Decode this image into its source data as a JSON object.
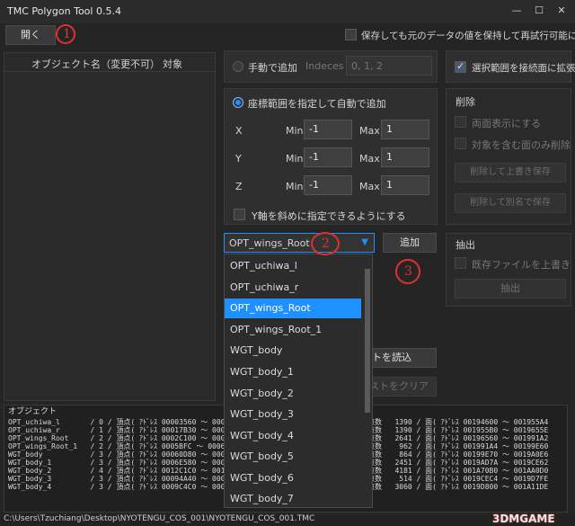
{
  "window": {
    "title": "TMC Polygon Tool 0.5.4",
    "minimize": "—",
    "maximize": "☐",
    "close": "✕"
  },
  "toolbar": {
    "open_label": "開く",
    "keep_values_label": "保存しても元のデータの値を保持して再試行可能にする"
  },
  "object_list": {
    "col_name": "オブジェクト名（変更不可）",
    "col_object": "対象"
  },
  "manual_add": {
    "label": "手動で追加",
    "indices_label": "Indeces",
    "indices_placeholder": "0, 1, 2"
  },
  "auto_add": {
    "label": "座標範囲を指定して自動で追加",
    "x_label": "X",
    "y_label": "Y",
    "z_label": "Z",
    "min_label": "Min",
    "max_label": "Max",
    "x_min": "-1",
    "x_max": "1",
    "y_min": "-1",
    "y_max": "1",
    "z_min": "-1",
    "z_max": "1",
    "y_oblique_label": "Y軸を斜めに指定できるようにする"
  },
  "object_select": {
    "value": "OPT_wings_Root",
    "add_label": "追加",
    "options": [
      "OPT_uchiwa_l",
      "OPT_uchiwa_r",
      "OPT_wings_Root",
      "OPT_wings_Root_1",
      "WGT_body",
      "WGT_body_1",
      "WGT_body_2",
      "WGT_body_3",
      "WGT_body_4",
      "WGT_body_5",
      "WGT_body_6",
      "WGT_body_7"
    ],
    "selected_index": 2
  },
  "hidden_buttons": {
    "load_list": "トを読込",
    "clear_list": "ストをクリア"
  },
  "right_panel": {
    "expand_selection_label": "選択範囲を接続面に拡張",
    "delete_title": "削除",
    "double_sided_label": "両面表示にする",
    "only_contained_label": "対象を含む面のみ削除",
    "delete_overwrite_label": "削除して上書き保存",
    "delete_save_as_label": "削除して別名で保存",
    "extract_title": "抽出",
    "overwrite_existing_label": "既存ファイルを上書き",
    "extract_label": "抽出"
  },
  "log": {
    "header": "オブジェクト",
    "lines": [
      "OPT_uchiwa_l       / 0 / 頂点( ｱﾄﾞﾚｽ 00003560 ～ 0001",
      "OPT_uchiwa_r       / 1 / 頂点( ｱﾄﾞﾚｽ 00017B30 ～ 0002",
      "OPT_wings_Root     / 2 / 頂点( ｱﾄﾞﾚｽ 0002C100 ～ 0005",
      "OPT_wings_Root_1   / 2 / 頂点( ｱﾄﾞﾚｽ 0005BFC ～ 0006",
      "WGT_body           / 3 / 頂点( ｱﾄﾞﾚｽ 00060D80 ～ 0006",
      "WGT_body_1         / 3 / 頂点( ｱﾄﾞﾚｽ 0006E580 ～ 0001",
      "WGT_body_2         / 4 / 頂点( ｱﾄﾞﾚｽ 0012C1C0 ～ 0016",
      "WGT_body_3         / 3 / 頂点( ｱﾄﾞﾚｽ 00094A40 ～ 0009",
      "WGT_body_4         / 3 / 頂点( ｱﾄﾞﾚｽ 0009C4C0 ～ 0000"
    ],
    "right_lines": [
      "点数   1390 / 面( ｱﾄﾞﾚｽ 00194600 ～ 001955A4",
      "点数   1390 / 面( ｱﾄﾞﾚｽ 001955B0 ～ 0019655E",
      "点数   2641 / 面( ｱﾄﾞﾚｽ 00196560 ～ 001991A2",
      "点数    962 / 面( ｱﾄﾞﾚｽ 001991A4 ～ 00199E60",
      "点数    864 / 面( ｱﾄﾞﾚｽ 00199E70 ～ 0019A0E6",
      "点数   2451 / 面( ｱﾄﾞﾚｽ 0019AD7A ～ 0019CE62",
      "点数   4181 / 面( ｱﾄﾞﾚｽ 001A70B0 ～ 001AA0D0",
      "点数    514 / 面( ｱﾄﾞﾚｽ 0019CEC4 ～ 0019D7FE",
      "点数   3060 / 面( ｱﾄﾞﾚｽ 0019D800 ～ 001A11DE"
    ]
  },
  "status_bar": {
    "path": "C:\\Users\\Tzuchiang\\Desktop\\NYOTENGU_COS_001\\NYOTENGU_COS_001.TMC"
  },
  "annotations": {
    "one": "1",
    "two": "2",
    "three": "3"
  },
  "watermark": "3DMGAME",
  "accent_color": "#1e90ff"
}
